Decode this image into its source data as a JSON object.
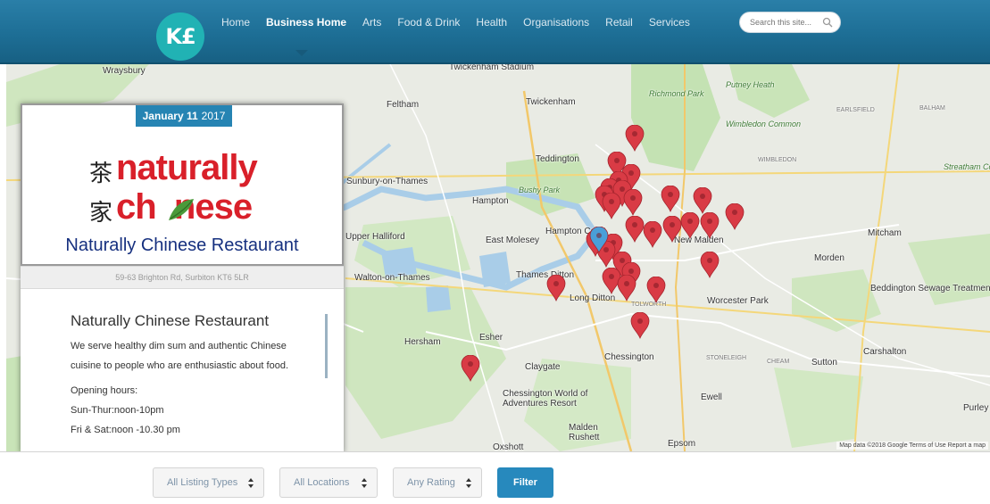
{
  "logo": {
    "text": "K£"
  },
  "nav": {
    "items": [
      {
        "label": "Home",
        "active": false
      },
      {
        "label": "Business Home",
        "active": true
      },
      {
        "label": "Arts",
        "active": false
      },
      {
        "label": "Food & Drink",
        "active": false
      },
      {
        "label": "Health",
        "active": false
      },
      {
        "label": "Organisations",
        "active": false
      },
      {
        "label": "Retail",
        "active": false
      },
      {
        "label": "Services",
        "active": false
      }
    ]
  },
  "search": {
    "placeholder": "Search this site..."
  },
  "map": {
    "labels": [
      {
        "text": "Wraysbury",
        "cls": "town"
      },
      {
        "text": "Twickenham Stadium",
        "cls": "town"
      },
      {
        "text": "Richmond Park",
        "cls": "park"
      },
      {
        "text": "Putney Heath",
        "cls": "park"
      },
      {
        "text": "Feltham",
        "cls": "town"
      },
      {
        "text": "Twickenham",
        "cls": "town"
      },
      {
        "text": "EARLSFIELD",
        "cls": "small"
      },
      {
        "text": "BALHAM",
        "cls": "small"
      },
      {
        "text": "Wimbledon Common",
        "cls": "park"
      },
      {
        "text": "Teddington",
        "cls": "town"
      },
      {
        "text": "Sunbury-on-Thames",
        "cls": "town"
      },
      {
        "text": "Bushy Park",
        "cls": "park"
      },
      {
        "text": "Hampton",
        "cls": "town"
      },
      {
        "text": "Streatham Common",
        "cls": "park"
      },
      {
        "text": "WIMBLEDON",
        "cls": "small"
      },
      {
        "text": "Upper Halliford",
        "cls": "town"
      },
      {
        "text": "East Molesey",
        "cls": "town"
      },
      {
        "text": "Hampton Court",
        "cls": "town"
      },
      {
        "text": "New Malden",
        "cls": "town"
      },
      {
        "text": "Mitcham",
        "cls": "town"
      },
      {
        "text": "Walton-on-Thames",
        "cls": "town"
      },
      {
        "text": "Thames Ditton",
        "cls": "town"
      },
      {
        "text": "Morden",
        "cls": "town"
      },
      {
        "text": "Long Ditton",
        "cls": "town"
      },
      {
        "text": "TOLWORTH",
        "cls": "small"
      },
      {
        "text": "Worcester Park",
        "cls": "town"
      },
      {
        "text": "Beddington Sewage Treatment Works",
        "cls": "town"
      },
      {
        "text": "Hersham",
        "cls": "town"
      },
      {
        "text": "Esher",
        "cls": "town"
      },
      {
        "text": "Chessington",
        "cls": "town"
      },
      {
        "text": "STONELEIGH",
        "cls": "small"
      },
      {
        "text": "CHEAM",
        "cls": "small"
      },
      {
        "text": "Sutton",
        "cls": "town"
      },
      {
        "text": "Carshalton",
        "cls": "town"
      },
      {
        "text": "Claygate",
        "cls": "town"
      },
      {
        "text": "Chessington World of Adventures Resort",
        "cls": "town"
      },
      {
        "text": "Ewell",
        "cls": "town"
      },
      {
        "text": "Malden Rushett",
        "cls": "town"
      },
      {
        "text": "Epsom",
        "cls": "town"
      },
      {
        "text": "Oxshott",
        "cls": "town"
      },
      {
        "text": "Purley",
        "cls": "town"
      }
    ],
    "credit": "Map data ©2018 Google   Terms of Use   Report a map"
  },
  "listing": {
    "date_day": "January 11",
    "date_year": "2017",
    "brand_line1": "naturally",
    "brand_line2": "ch  nese",
    "brand_cjk1": "茶",
    "brand_cjk2": "家",
    "caption": "Naturally Chinese Restaurant",
    "address": "59-63 Brighton Rd, Surbiton KT6 5LR",
    "title": "Naturally Chinese Restaurant",
    "desc_line1": "We serve healthy dim sum and authentic Chinese",
    "desc_line2": "cuisine to people who are enthusiastic about food.",
    "hours_label": "Opening hours:",
    "hours_1": "Sun-Thur:noon-10pm",
    "hours_2": "Fri & Sat:noon -10.30 pm"
  },
  "filters": {
    "listing_types": "All Listing Types",
    "locations": "All Locations",
    "rating": "Any Rating",
    "button": "Filter"
  },
  "colors": {
    "header": "#1d6e95",
    "pin": "#d93b45",
    "pin_active": "#4a9fd8",
    "button": "#2789bd",
    "brand_red": "#d9202a"
  }
}
